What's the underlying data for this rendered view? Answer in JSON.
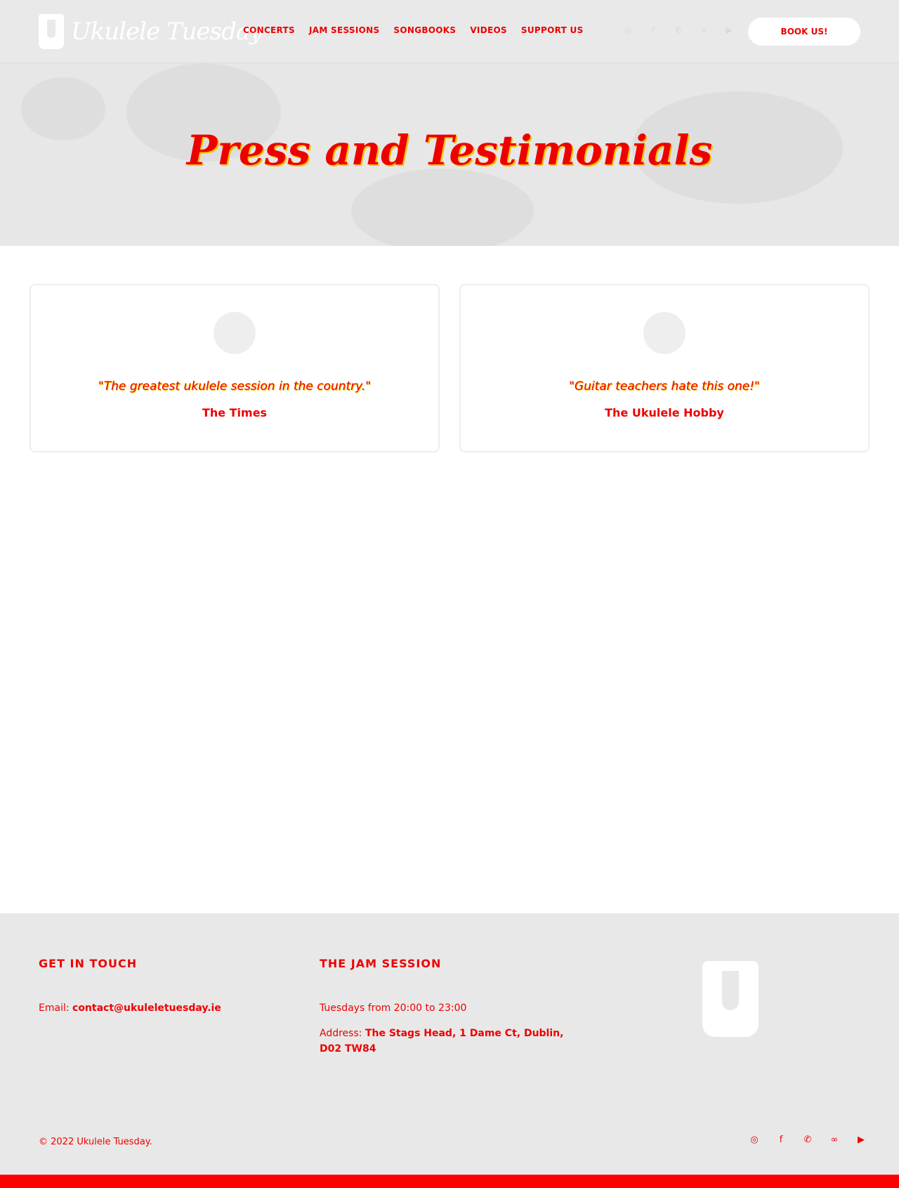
{
  "header": {
    "logo_text": "Ukulele Tuesday",
    "nav": [
      "CONCERTS",
      "JAM SESSIONS",
      "SONGBOOKS",
      "VIDEOS",
      "SUPPORT US"
    ],
    "social_icons": [
      "instagram-icon",
      "facebook-icon",
      "whatsapp-icon",
      "tripadvisor-icon",
      "youtube-icon"
    ],
    "book_label": "BOOK US!"
  },
  "hero": {
    "title": "Press and Testimonials"
  },
  "testimonials": [
    {
      "quote": "\"The greatest ukulele session in the country.\"",
      "source": "The Times"
    },
    {
      "quote": "\"Guitar teachers hate this one!\"",
      "source": "The Ukulele Hobby"
    }
  ],
  "footer": {
    "get_in_touch_heading": "GET IN TOUCH",
    "email_label": "Email:",
    "email_value": "contact@ukuleletuesday.ie",
    "jam_heading": "THE JAM SESSION",
    "schedule": "Tuesdays from 20:00 to 23:00",
    "address_label": "Address:",
    "address_value": "The Stags Head, 1 Dame Ct, Dublin, D02 TW84",
    "copyright": "© 2022 Ukulele Tuesday.",
    "social_icons": [
      "instagram-icon",
      "facebook-icon",
      "whatsapp-icon",
      "tripadvisor-icon",
      "youtube-icon"
    ]
  },
  "colors": {
    "accent": "#ee0000",
    "shadow": "#f5c400",
    "header_bg": "#e9e9e9",
    "footer_bg": "#e8e8e8"
  }
}
